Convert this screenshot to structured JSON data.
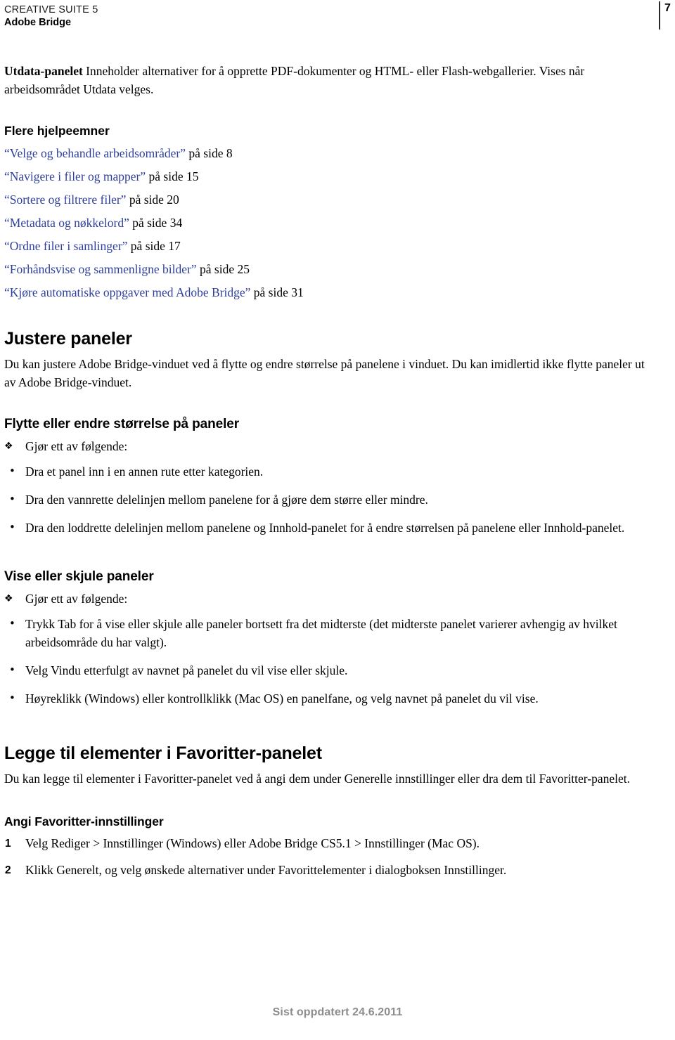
{
  "header": {
    "suite_line": "CREATIVE SUITE 5",
    "product_line": "Adobe Bridge",
    "page_number": "7"
  },
  "intro": {
    "term": "Utdata-panelet",
    "definition": "Inneholder alternativer for å opprette PDF-dokumenter og HTML- eller Flash-webgallerier. Vises når arbeidsområdet Utdata velges."
  },
  "more_help": {
    "heading": "Flere hjelpeemner",
    "items": [
      {
        "link": "“Velge og behandle arbeidsområder”",
        "page": "på side 8"
      },
      {
        "link": "“Navigere i filer og mapper”",
        "page": "på side 15"
      },
      {
        "link": "“Sortere og filtrere filer”",
        "page": "på side 20"
      },
      {
        "link": "“Metadata og nøkkelord”",
        "page": "på side 34"
      },
      {
        "link": "“Ordne filer i samlinger”",
        "page": "på side 17"
      },
      {
        "link": "“Forhåndsvise og sammenligne bilder”",
        "page": "på side 25"
      },
      {
        "link": "“Kjøre automatiske oppgaver med Adobe Bridge”",
        "page": "på side 31"
      }
    ]
  },
  "section_adjust": {
    "heading": "Justere paneler",
    "paragraph": "Du kan justere Adobe Bridge-vinduet ved å flytte og endre størrelse på panelene i vinduet. Du kan imidlertid ikke flytte paneler ut av Adobe Bridge-vinduet.",
    "sub_move": {
      "heading": "Flytte eller endre størrelse på paneler",
      "lead": "Gjør ett av følgende:",
      "lead_marker": "❖",
      "bullet_marker": "•",
      "bullets": [
        "Dra et panel inn i en annen rute etter kategorien.",
        "Dra den vannrette delelinjen mellom panelene for å gjøre dem større eller mindre.",
        "Dra den loddrette delelinjen mellom panelene og Innhold-panelet for å endre størrelsen på panelene eller Innhold-panelet."
      ]
    },
    "sub_show": {
      "heading": "Vise eller skjule paneler",
      "lead": "Gjør ett av følgende:",
      "lead_marker": "❖",
      "bullet_marker": "•",
      "bullets": [
        "Trykk Tab for å vise eller skjule alle paneler bortsett fra det midterste (det midterste panelet varierer avhengig av hvilket arbeidsområde du har valgt).",
        "Velg Vindu etterfulgt av navnet på panelet du vil vise eller skjule.",
        "Høyreklikk (Windows) eller kontrollklikk (Mac OS) en panelfane, og velg navnet på panelet du vil vise."
      ]
    }
  },
  "section_favorites": {
    "heading": "Legge til elementer i Favoritter-panelet",
    "paragraph": "Du kan legge til elementer i Favoritter-panelet ved å angi dem under Generelle innstillinger eller dra dem til Favoritter-panelet.",
    "sub_prefs": {
      "heading": "Angi Favoritter-innstillinger",
      "steps": [
        {
          "num": "1",
          "text": "Velg Rediger > Innstillinger (Windows) eller Adobe Bridge CS5.1 > Innstillinger (Mac OS)."
        },
        {
          "num": "2",
          "text": "Klikk Generelt, og velg ønskede alternativer under Favorittelementer i dialogboksen Innstillinger."
        }
      ]
    }
  },
  "footer": {
    "text": "Sist oppdatert 24.6.2011"
  },
  "colors": {
    "link": "#2f3f9c",
    "footer_gray": "#8d8d8d",
    "text": "#000000"
  }
}
